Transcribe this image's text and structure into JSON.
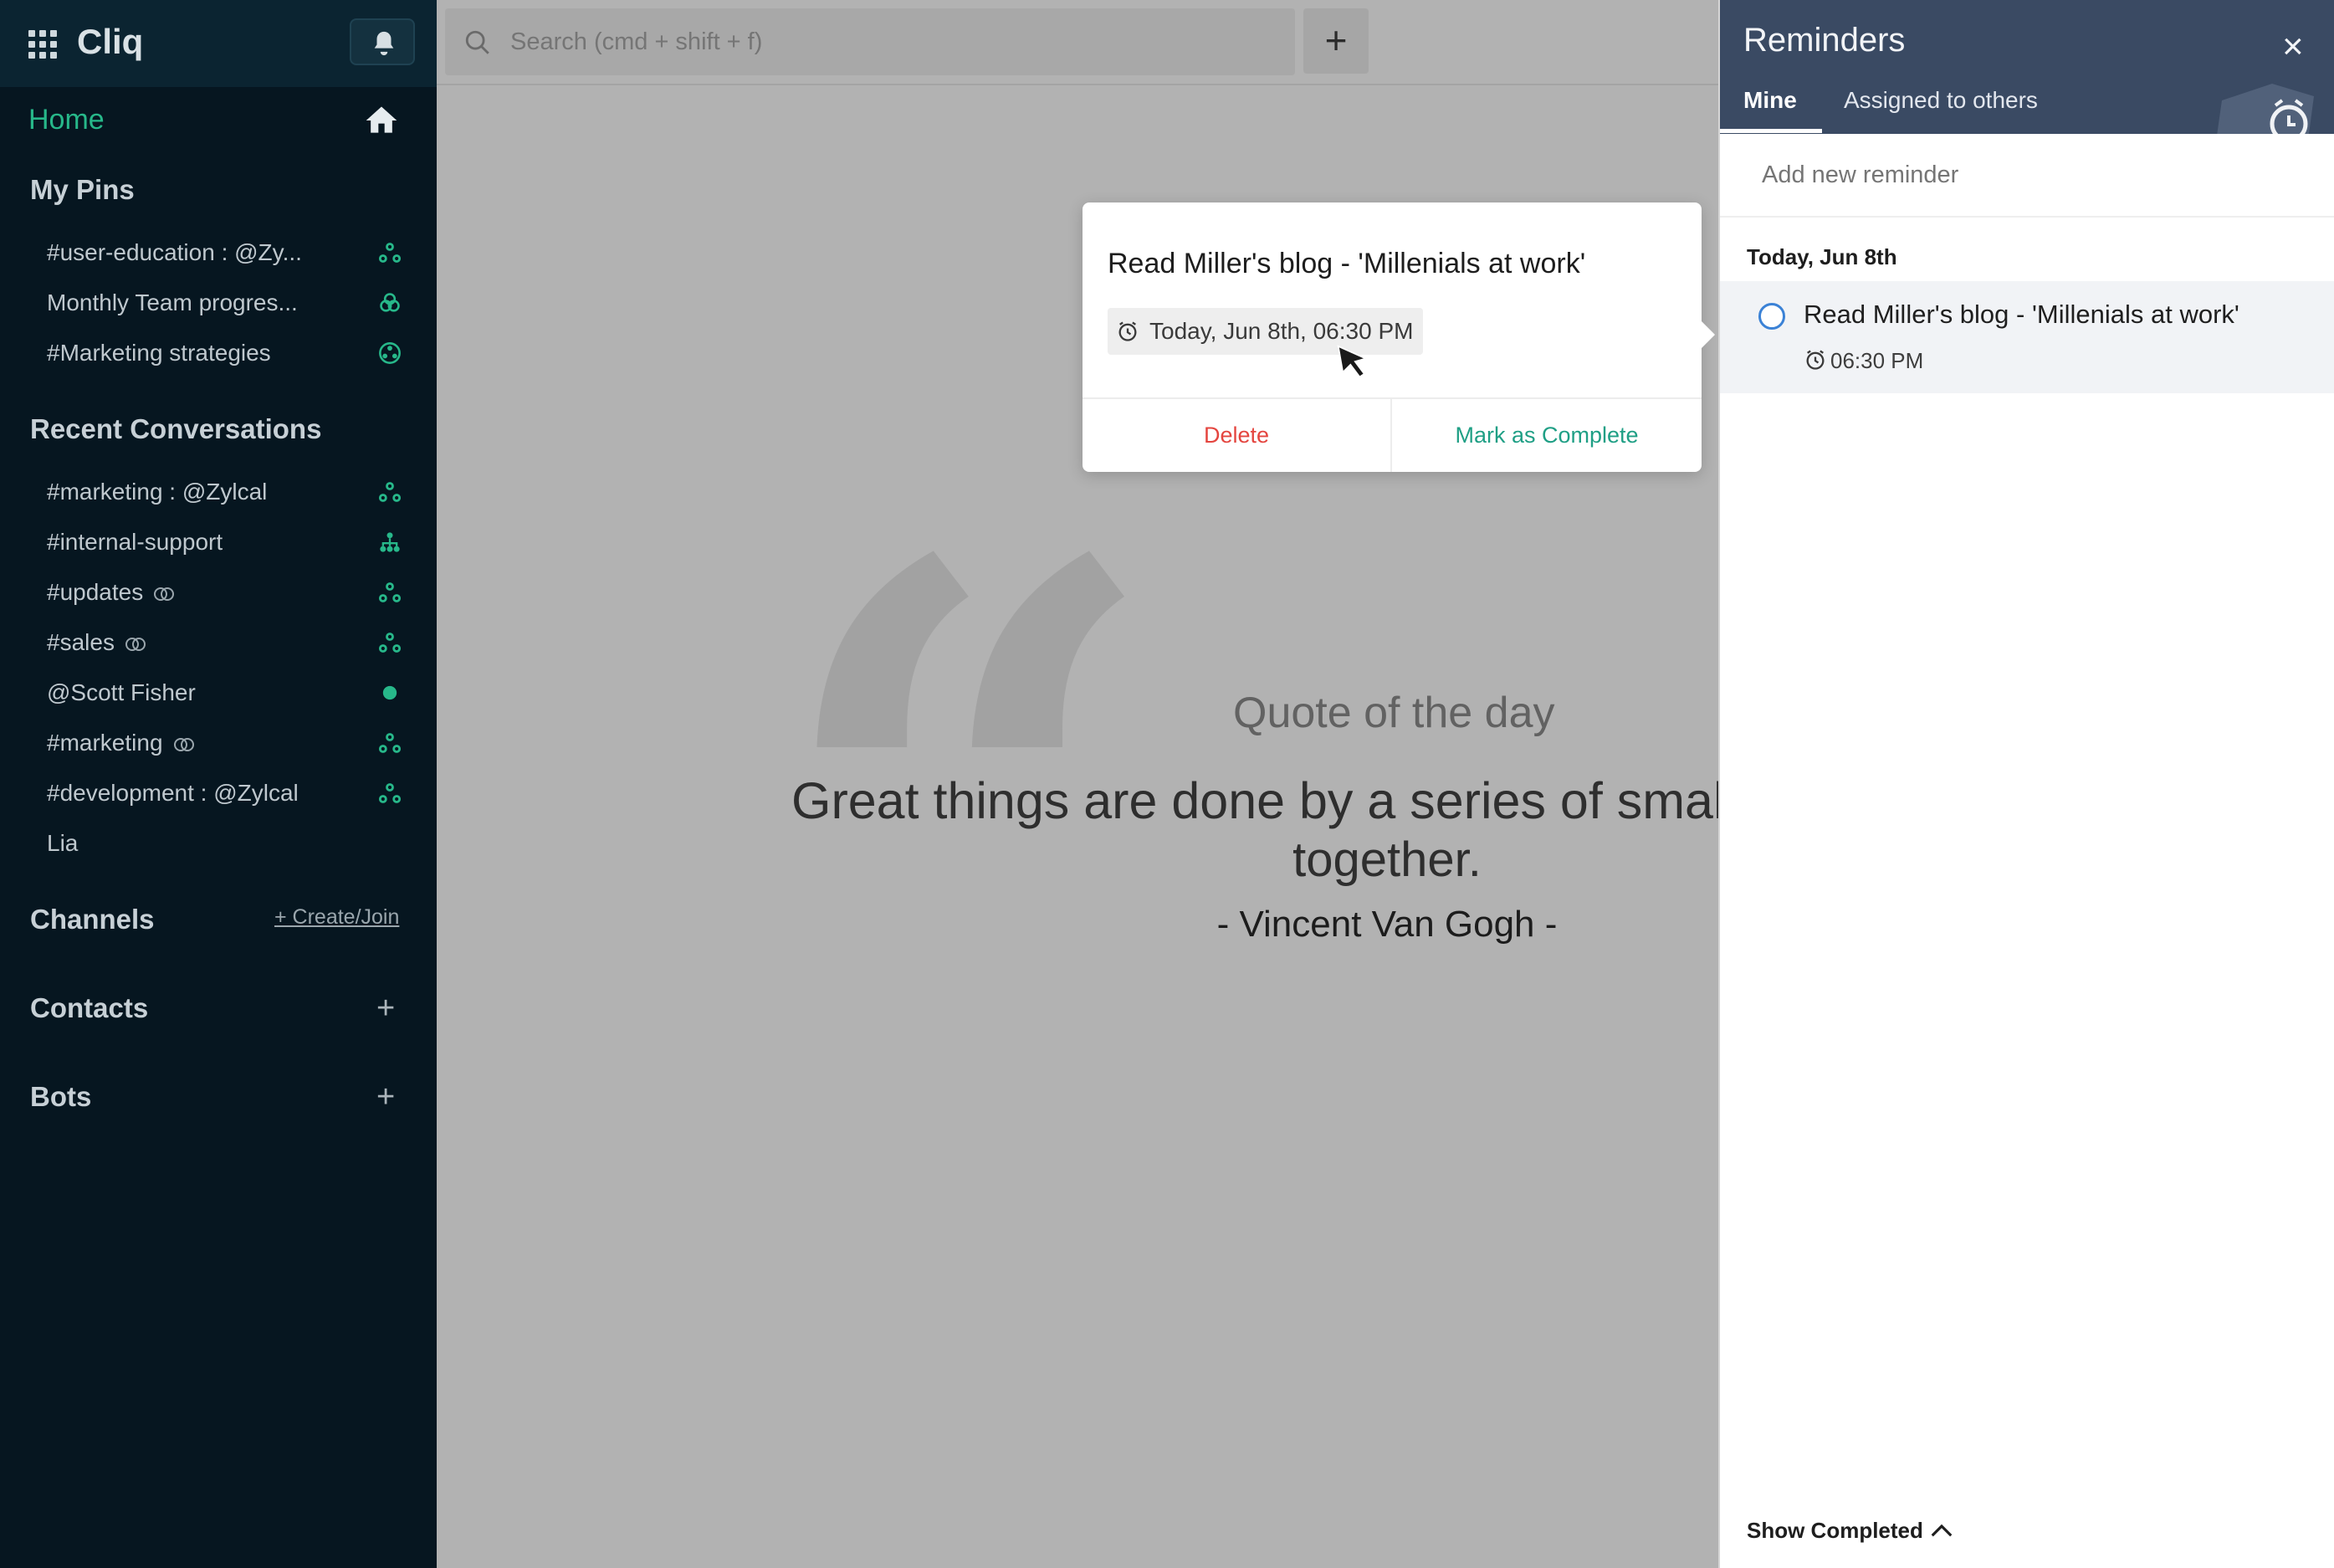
{
  "sidebar": {
    "brand": "Cliq",
    "home_label": "Home",
    "pins_title": "My Pins",
    "pins": [
      {
        "label": "#user-education : @Zy..."
      },
      {
        "label": "Monthly Team progres..."
      },
      {
        "label": "#Marketing strategies"
      }
    ],
    "recent_title": "Recent Conversations",
    "recent": [
      {
        "label": "#marketing : @Zylcal"
      },
      {
        "label": "#internal-support"
      },
      {
        "label": "#updates"
      },
      {
        "label": "#sales"
      },
      {
        "label": "@Scott Fisher"
      },
      {
        "label": "#marketing"
      },
      {
        "label": "#development : @Zylcal"
      },
      {
        "label": "Lia"
      }
    ],
    "channels_title": "Channels",
    "create_join": "+ Create/Join",
    "contacts_title": "Contacts",
    "bots_title": "Bots",
    "accent": "#27b88a"
  },
  "search": {
    "placeholder": "Search (cmd + shift + f)",
    "add_label": "+"
  },
  "quote": {
    "title": "Quote of the day",
    "text_line1": "Great things are done by a series of small thi",
    "text_line2": "together.",
    "author": "- Vincent Van Gogh -"
  },
  "popup": {
    "title": "Read Miller's blog - 'Millenials at work'",
    "time": "Today, Jun 8th, 06:30 PM",
    "delete_label": "Delete",
    "complete_label": "Mark as Complete"
  },
  "reminders": {
    "title": "Reminders",
    "close_label": "×",
    "tabs": [
      {
        "label": "Mine"
      },
      {
        "label": "Assigned to others"
      }
    ],
    "add_placeholder": "Add new reminder",
    "day": "Today, Jun 8th",
    "items": [
      {
        "title": "Read Miller's blog - 'Millenials at work'",
        "time": "06:30 PM"
      }
    ],
    "show_completed": "Show Completed",
    "header_color": "#3a4a63"
  }
}
